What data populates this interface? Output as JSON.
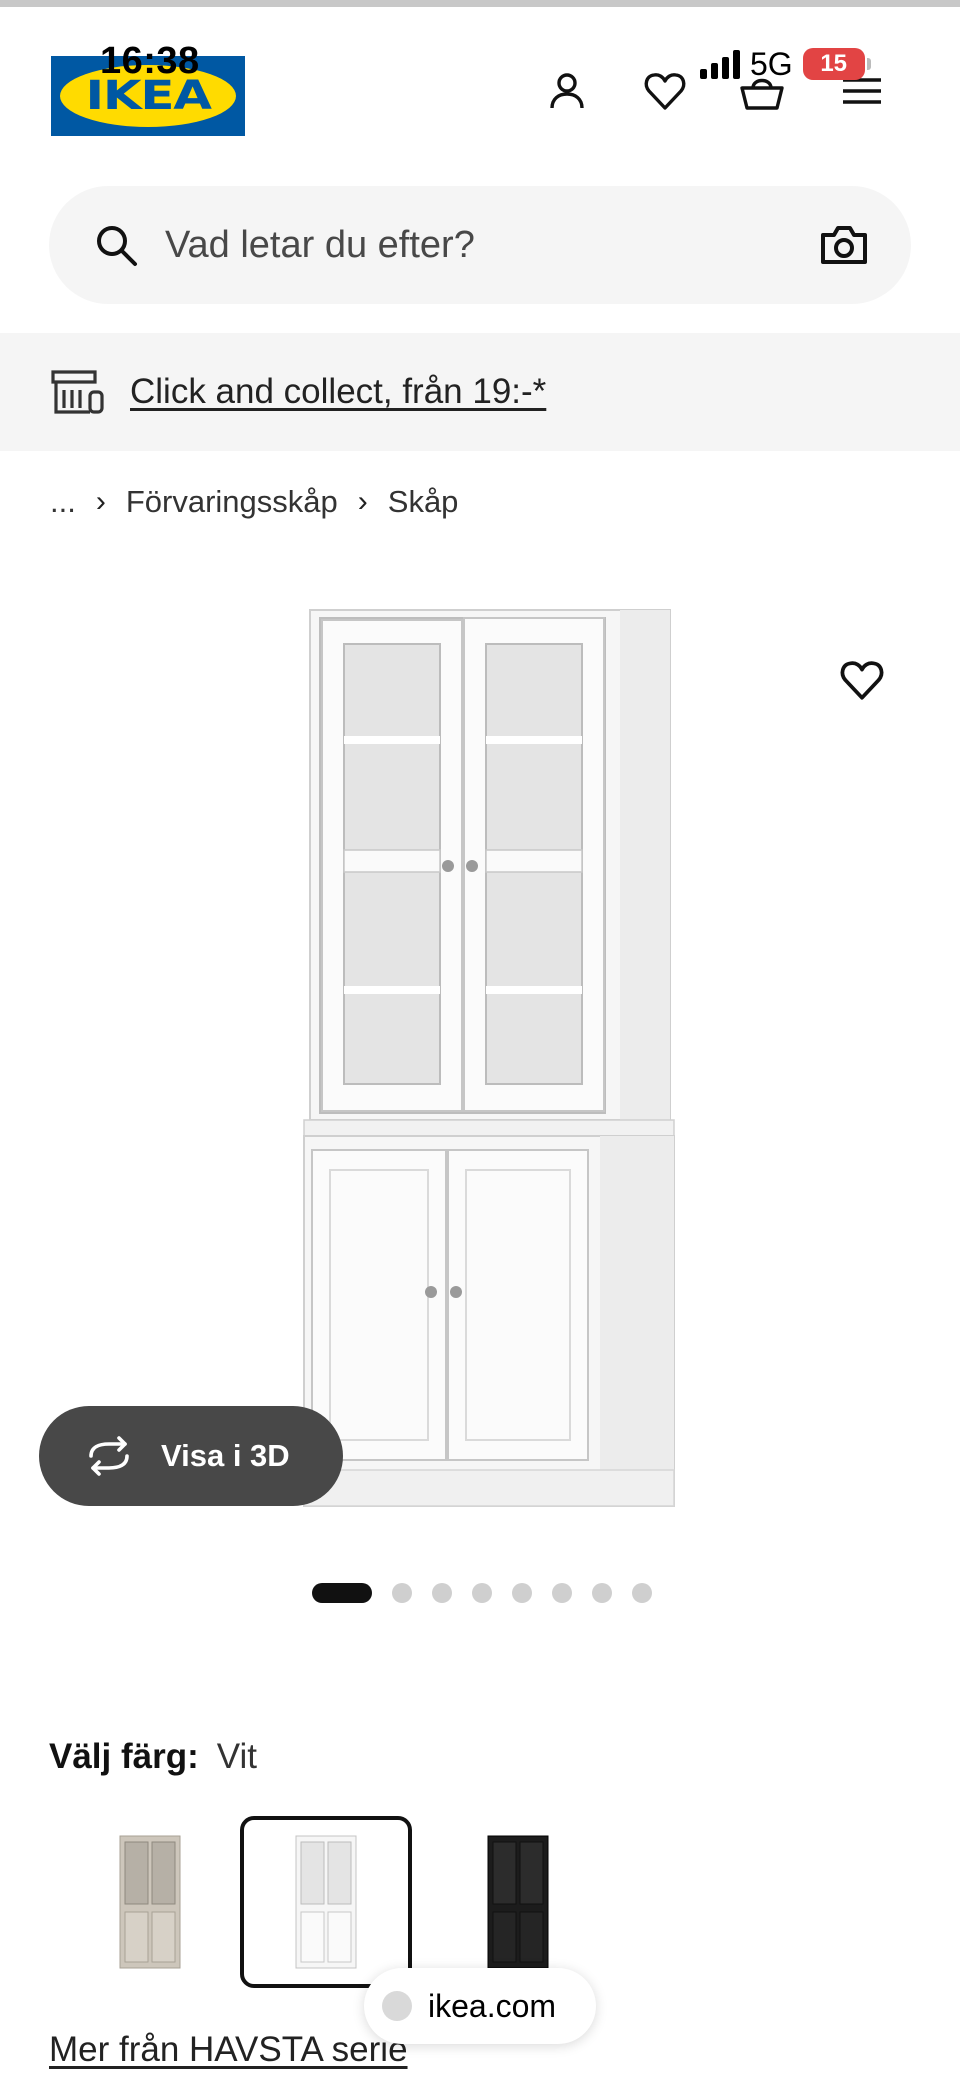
{
  "status_bar": {
    "time": "16:38",
    "network": "5G",
    "battery": "15"
  },
  "header": {
    "logo_text": "IKEA",
    "icons": [
      "user-icon",
      "heart-icon",
      "basket-icon",
      "menu-icon"
    ]
  },
  "search": {
    "placeholder": "Vad letar du efter?"
  },
  "promo": {
    "text": "Click and collect, från 19:-*"
  },
  "breadcrumb": {
    "ellipsis": "...",
    "items": [
      "Förvaringsskåp",
      "Skåp"
    ]
  },
  "product": {
    "view_3d_label": "Visa i 3D",
    "image_count": 8,
    "active_image": 1
  },
  "color_picker": {
    "label": "Välj färg:",
    "selected": "Vit",
    "swatches": [
      {
        "name": "beige",
        "color": "#cdc6bb",
        "selected": false
      },
      {
        "name": "white",
        "color": "#f4f4f4",
        "selected": true
      },
      {
        "name": "black",
        "color": "#1c1c1c",
        "selected": false
      }
    ]
  },
  "series_link": "Mer från HAVSTA serie",
  "browser": {
    "url": "ikea.com"
  },
  "colors": {
    "brand_blue": "#0058a3",
    "brand_yellow": "#ffdb00",
    "button_dark": "#484848",
    "panel_bg": "#f5f5f5"
  }
}
